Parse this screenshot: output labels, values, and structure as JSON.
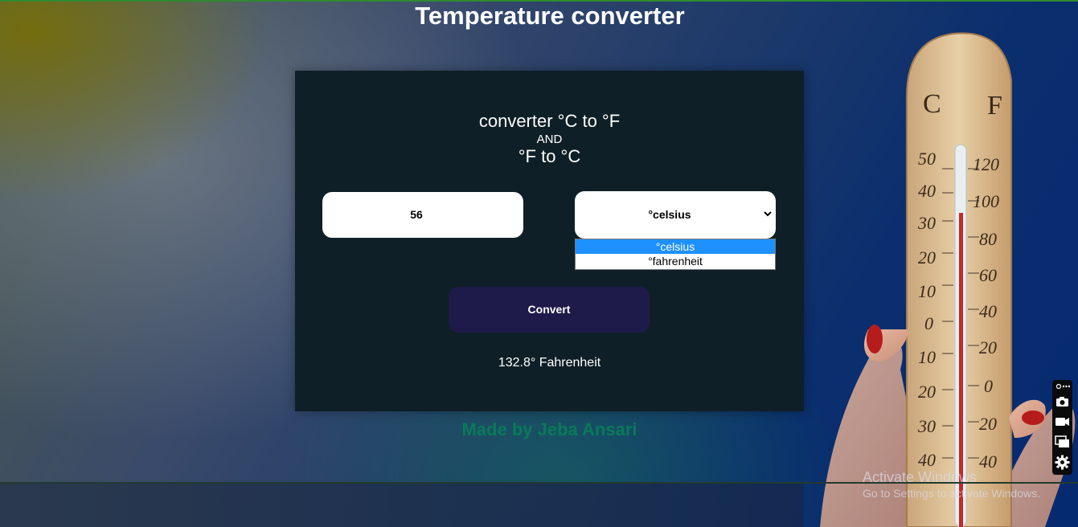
{
  "page": {
    "title": "Temperature converter"
  },
  "card": {
    "heading_line1": "converter °C to °F",
    "heading_line2": "AND",
    "heading_line3": "°F to °C",
    "input_value": "56",
    "unit_selected": "°celsius",
    "unit_options": [
      "°celsius",
      "°fahrenheit"
    ],
    "convert_label": "Convert",
    "result": "132.8° Fahrenheit"
  },
  "footer": {
    "credit": "Made by Jeba Ansari"
  },
  "thermometer": {
    "scale_c_label": "C",
    "scale_f_label": "F",
    "celsius_ticks": [
      "50",
      "40",
      "30",
      "20",
      "10",
      "0",
      "10",
      "20",
      "30",
      "40"
    ],
    "fahrenheit_ticks": [
      "120",
      "100",
      "80",
      "60",
      "40",
      "20",
      "0",
      "20",
      "40"
    ]
  },
  "watermark": {
    "title": "Activate Windows",
    "subtitle": "Go to Settings to activate Windows."
  },
  "toolbar": {
    "icons": [
      "more-icon",
      "camera-icon",
      "video-icon",
      "window-icon",
      "settings-icon"
    ]
  },
  "colors": {
    "card_bg": "#0f1f27",
    "button_bg": "#1e1b4b",
    "credit_color": "#0a7a5a",
    "selected_option": "#1e90ff"
  }
}
